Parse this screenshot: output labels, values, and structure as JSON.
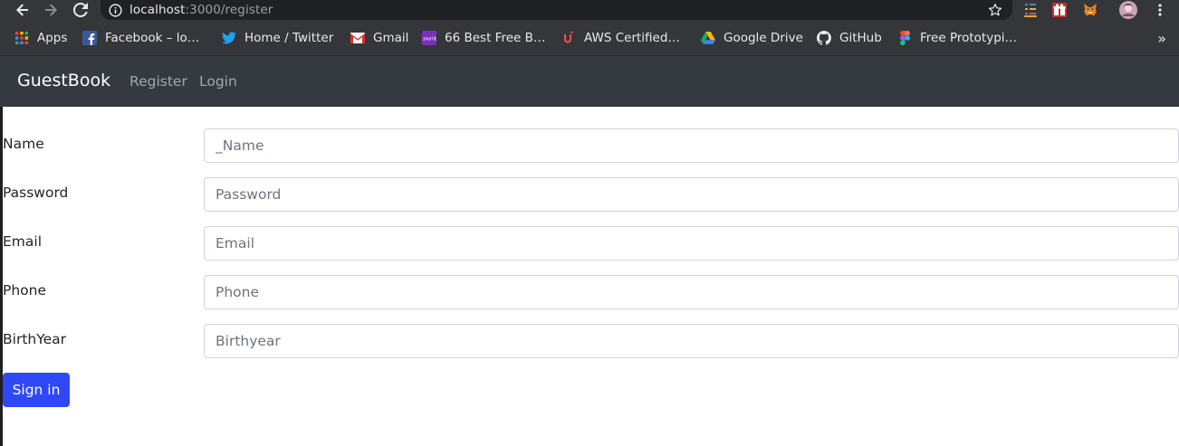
{
  "browser": {
    "url_host": "localhost",
    "url_path": ":3000/register",
    "bookmarks": [
      {
        "label": "Apps",
        "icon": "apps-grid-icon"
      },
      {
        "label": "Facebook – lo…",
        "icon": "facebook-icon"
      },
      {
        "label": "Home / Twitter",
        "icon": "twitter-icon"
      },
      {
        "label": "Gmail",
        "icon": "gmail-icon"
      },
      {
        "label": "66 Best Free B…",
        "icon": "colorlib-icon"
      },
      {
        "label": "AWS Certified…",
        "icon": "udemy-icon"
      },
      {
        "label": "Google Drive",
        "icon": "google-drive-icon"
      },
      {
        "label": "GitHub",
        "icon": "github-icon"
      },
      {
        "label": "Free Prototypi…",
        "icon": "figma-icon"
      }
    ],
    "overflow_label": "»"
  },
  "navbar": {
    "brand": "GuestBook",
    "links": [
      "Register",
      "Login"
    ]
  },
  "form": {
    "fields": [
      {
        "label": "Name",
        "placeholder": "_Name",
        "value": ""
      },
      {
        "label": "Password",
        "placeholder": "Password",
        "value": ""
      },
      {
        "label": "Email",
        "placeholder": "Email",
        "value": ""
      },
      {
        "label": "Phone",
        "placeholder": "Phone",
        "value": ""
      },
      {
        "label": "BirthYear",
        "placeholder": "Birthyear",
        "value": ""
      }
    ],
    "submit_label": "Sign in"
  },
  "colors": {
    "browser_chrome": "#35363a",
    "navbar_bg": "#343a40",
    "primary_button": "#2e48f5"
  }
}
